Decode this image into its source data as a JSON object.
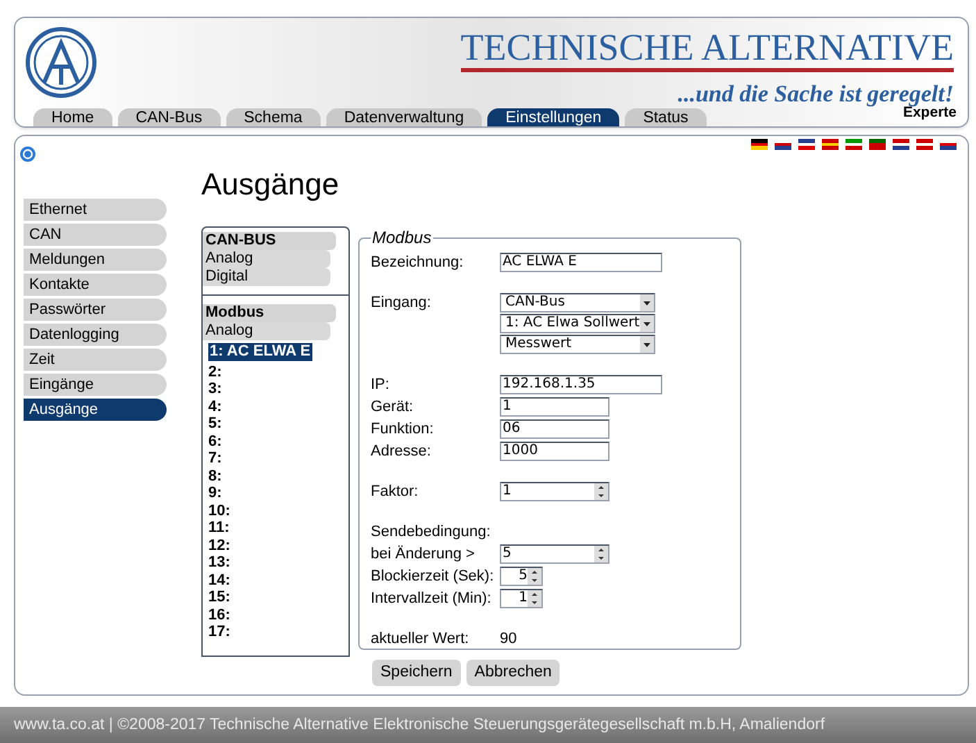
{
  "header": {
    "brand": "TECHNISCHE ALTERNATIVE",
    "slogan": "...und die Sache ist geregelt!",
    "mode": "Experte"
  },
  "tabs": [
    {
      "label": "Home",
      "selected": false
    },
    {
      "label": "CAN-Bus",
      "selected": false
    },
    {
      "label": "Schema",
      "selected": false
    },
    {
      "label": "Datenverwaltung",
      "selected": false
    },
    {
      "label": "Einstellungen",
      "selected": true
    },
    {
      "label": "Status",
      "selected": false
    }
  ],
  "sidebar": {
    "items": [
      {
        "label": "Ethernet",
        "selected": false
      },
      {
        "label": "CAN",
        "selected": false
      },
      {
        "label": "Meldungen",
        "selected": false
      },
      {
        "label": "Kontakte",
        "selected": false
      },
      {
        "label": "Passwörter",
        "selected": false
      },
      {
        "label": "Datenlogging",
        "selected": false
      },
      {
        "label": "Zeit",
        "selected": false
      },
      {
        "label": "Eingänge",
        "selected": false
      },
      {
        "label": "Ausgänge",
        "selected": true
      }
    ]
  },
  "page_title": "Ausgänge",
  "output_list": {
    "groups": [
      {
        "title": "CAN-BUS",
        "items": [
          "Analog",
          "Digital"
        ]
      },
      {
        "title": "Modbus",
        "items": [
          "Analog"
        ],
        "outputs": [
          {
            "label": "1: AC ELWA E",
            "selected": true
          },
          {
            "label": "2:",
            "selected": false
          },
          {
            "label": "3:",
            "selected": false
          },
          {
            "label": "4:",
            "selected": false
          },
          {
            "label": "5:",
            "selected": false
          },
          {
            "label": "6:",
            "selected": false
          },
          {
            "label": "7:",
            "selected": false
          },
          {
            "label": "8:",
            "selected": false
          },
          {
            "label": "9:",
            "selected": false
          },
          {
            "label": "10:",
            "selected": false
          },
          {
            "label": "11:",
            "selected": false
          },
          {
            "label": "12:",
            "selected": false
          },
          {
            "label": "13:",
            "selected": false
          },
          {
            "label": "14:",
            "selected": false
          },
          {
            "label": "15:",
            "selected": false
          },
          {
            "label": "16:",
            "selected": false
          },
          {
            "label": "17:",
            "selected": false
          }
        ]
      }
    ]
  },
  "form": {
    "legend": "Modbus",
    "groups": [
      [
        {
          "kind": "text_wide",
          "label": "Bezeichnung:",
          "value": "AC ELWA E"
        }
      ],
      [
        {
          "kind": "select",
          "label": "Eingang:",
          "options": [
            "CAN-Bus",
            "1: AC Elwa Sollwert",
            "Messwert"
          ]
        }
      ],
      [
        {
          "kind": "text_wide",
          "label": "IP:",
          "value": "192.168.1.35"
        },
        {
          "kind": "text",
          "label": "Gerät:",
          "value": "1"
        },
        {
          "kind": "text",
          "label": "Funktion:",
          "value": "06"
        },
        {
          "kind": "text",
          "label": "Adresse:",
          "value": "1000"
        }
      ],
      [
        {
          "kind": "spin",
          "label": "Faktor:",
          "value": "1"
        }
      ],
      [
        {
          "kind": "heading",
          "label": "Sendebedingung:"
        },
        {
          "kind": "spin",
          "label": "bei Änderung >",
          "value": "5"
        },
        {
          "kind": "spin_small",
          "label": "Blockierzeit (Sek):",
          "value": "5"
        },
        {
          "kind": "spin_small",
          "label": "Intervallzeit (Min):",
          "value": "1"
        }
      ],
      [
        {
          "kind": "readout",
          "label": "aktueller Wert:",
          "value": "90"
        }
      ]
    ]
  },
  "buttons": [
    "Speichern",
    "Abbrechen"
  ],
  "footer": "www.ta.co.at | ©2008-2017 Technische Alternative Elektronische Steuerungsgerätegesellschaft m.b.H, Amaliendorf"
}
